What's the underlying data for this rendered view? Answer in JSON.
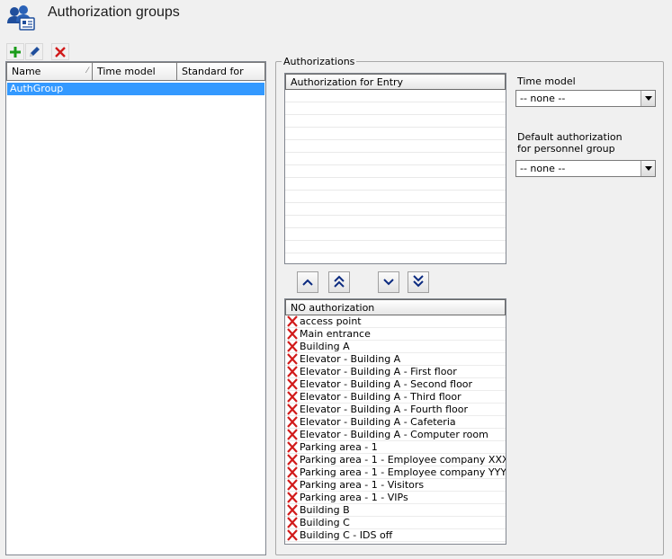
{
  "window": {
    "title": "Authorization groups",
    "title_icon": "users-card-icon"
  },
  "toolbar": {
    "buttons": [
      {
        "name": "add",
        "icon": "plus-icon",
        "color": "#1a9c1a"
      },
      {
        "name": "edit",
        "icon": "pencil-icon",
        "color": "#1f4e9c"
      },
      {
        "name": "delete",
        "icon": "close-icon",
        "color": "#d11a1a"
      }
    ]
  },
  "group_list": {
    "columns": [
      "Name",
      "Time model",
      "Standard for"
    ],
    "rows": [
      {
        "name": "AuthGroup",
        "time_model": "",
        "standard_for": "",
        "selected": true
      }
    ],
    "selection_color": "#3399ff"
  },
  "authorizations": {
    "group_label": "Authorizations",
    "entry_grid": {
      "header": "Authorization for Entry",
      "rows": []
    },
    "move_buttons": [
      {
        "name": "move-up",
        "icon": "chevron-up-icon"
      },
      {
        "name": "move-all-up",
        "icon": "double-chevron-up-icon"
      },
      {
        "name": "move-down",
        "icon": "chevron-down-icon"
      },
      {
        "name": "move-all-down",
        "icon": "double-chevron-down-icon"
      }
    ],
    "no_auth_grid": {
      "header": "NO authorization",
      "row_icon": "red-x-icon",
      "rows": [
        "access point",
        "Main entrance",
        "Building A",
        "Elevator - Building A",
        "Elevator - Building A - First floor",
        "Elevator - Building A - Second floor",
        "Elevator - Building A - Third floor",
        "Elevator - Building A - Fourth floor",
        "Elevator - Building A - Cafeteria",
        "Elevator - Building A - Computer room",
        "Parking area - 1",
        "Parking area - 1 - Employee company XXX",
        "Parking area - 1 - Employee company YYY",
        "Parking area - 1 - Visitors",
        "Parking area - 1 - VIPs",
        "Building B",
        "Building C",
        "Building C - IDS off"
      ]
    }
  },
  "time_model": {
    "label": "Time model",
    "value": "-- none --"
  },
  "default_authorization": {
    "label_line1": "Default authorization",
    "label_line2": "for personnel group",
    "value": "-- none --"
  },
  "colors": {
    "accent_blue": "#1f4e9c",
    "delete_red": "#d11a1a"
  }
}
